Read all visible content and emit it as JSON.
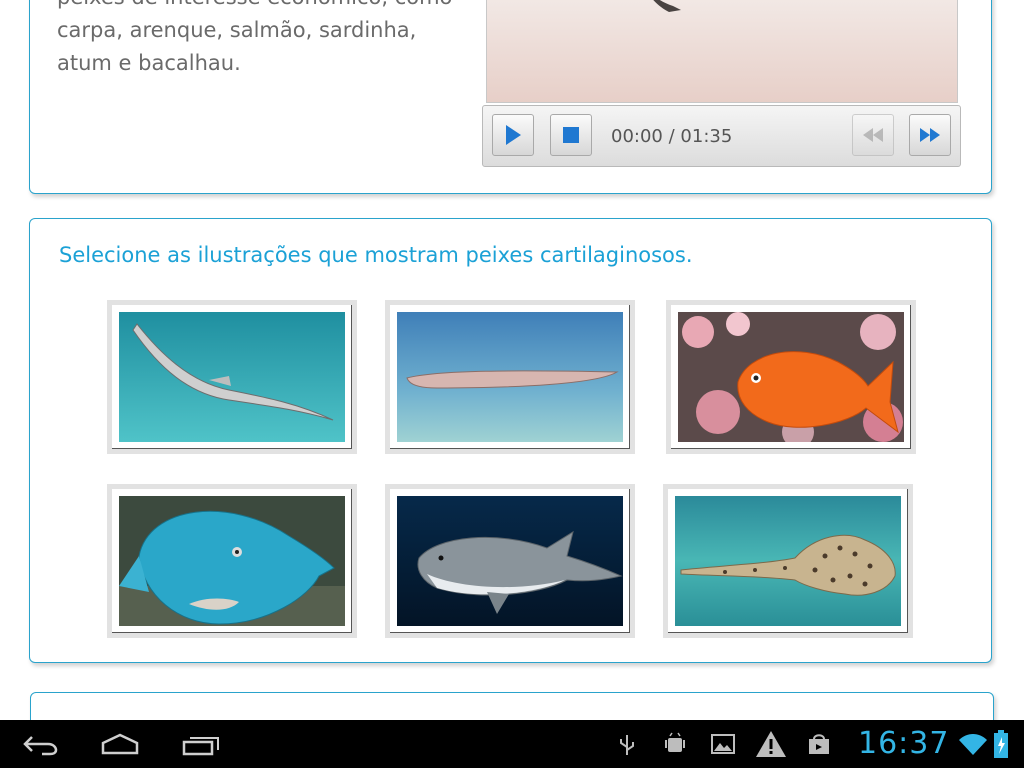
{
  "intro": {
    "line1": "peixes de interesse econômico, como",
    "line2": "carpa, arenque, salmão, sardinha,",
    "line3": "atum e bacalhau."
  },
  "player": {
    "current_time": "00:00",
    "separator": "/",
    "total_time": "01:35"
  },
  "quiz": {
    "question": "Selecione as ilustrações que mostram peixes cartilaginosos."
  },
  "statusbar": {
    "time": "16:37"
  },
  "colors": {
    "accent": "#1ba1d6",
    "card_border": "#2aa3cc",
    "clock": "#33b5e5"
  }
}
